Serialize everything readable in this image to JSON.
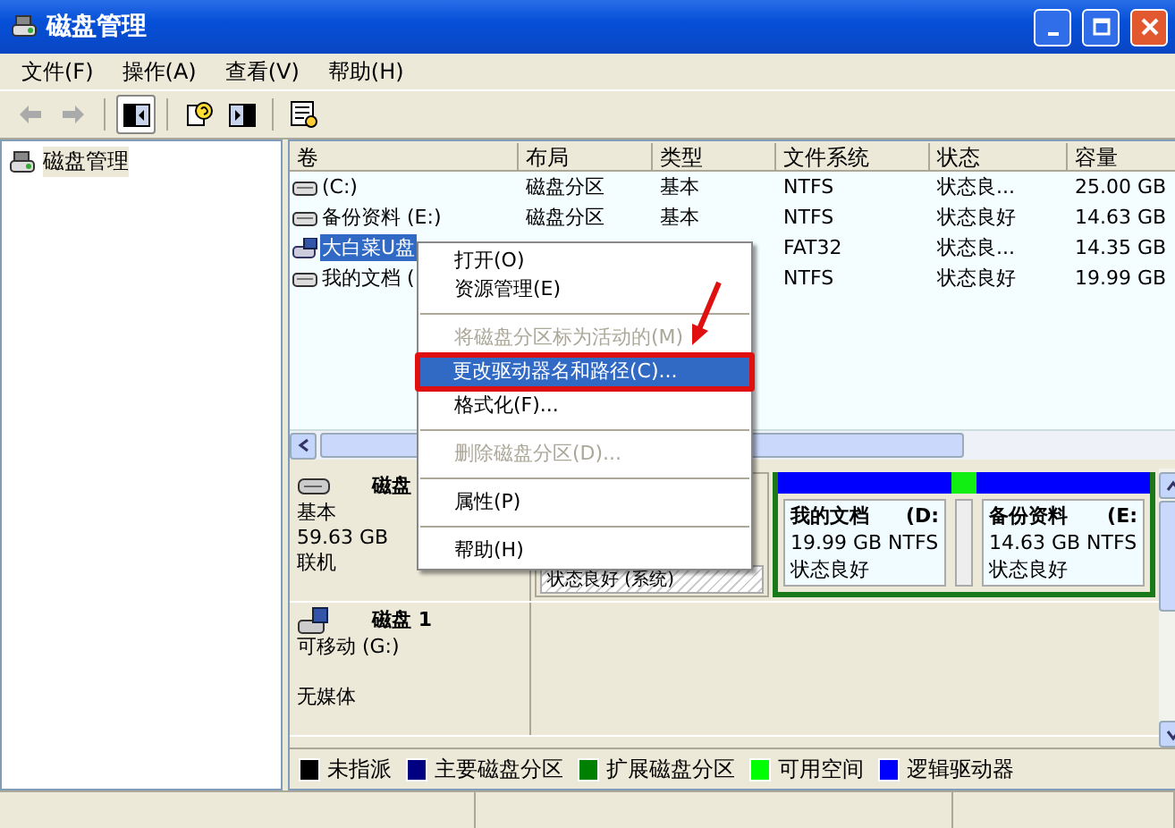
{
  "window": {
    "title": "磁盘管理"
  },
  "menu": [
    "文件(F)",
    "操作(A)",
    "查看(V)",
    "帮助(H)"
  ],
  "toolbar": [
    {
      "kind": "back",
      "disabled": true
    },
    {
      "kind": "forward",
      "disabled": true
    },
    {
      "kind": "sep"
    },
    {
      "kind": "tree",
      "pressed": true
    },
    {
      "kind": "sep"
    },
    {
      "kind": "help",
      "pressed": false
    },
    {
      "kind": "pane",
      "pressed": false
    },
    {
      "kind": "sep"
    },
    {
      "kind": "props",
      "pressed": false
    }
  ],
  "tree": [
    {
      "label": "磁盘管理",
      "selected": true
    }
  ],
  "table": {
    "columns": [
      "卷",
      "布局",
      "类型",
      "文件系统",
      "状态",
      "容量"
    ],
    "rows": [
      {
        "kind": "disk",
        "selected": false,
        "cells": [
          "(C:)",
          "磁盘分区",
          "基本",
          "NTFS",
          "状态良...",
          "25.00 GB"
        ]
      },
      {
        "kind": "disk",
        "selected": false,
        "cells": [
          "备份资料 (E:)",
          "磁盘分区",
          "基本",
          "NTFS",
          "状态良好",
          "14.63 GB"
        ]
      },
      {
        "kind": "usb",
        "selected": true,
        "cells": [
          "大白菜U盘",
          null,
          null,
          "FAT32",
          "状态良...",
          "14.35 GB"
        ]
      },
      {
        "kind": "disk",
        "selected": false,
        "cells": [
          "我的文档 (",
          null,
          null,
          "NTFS",
          "状态良好",
          "19.99 GB"
        ]
      }
    ]
  },
  "disks": [
    {
      "kind": "fixed",
      "name": "磁盘",
      "type": "基本",
      "size": "59.63 GB",
      "status": "联机",
      "partitions": [
        {
          "kind": "primary",
          "lines": [
            "状态良好 (系统)"
          ]
        },
        {
          "kind": "extended",
          "children": [
            {
              "kind": "logical",
              "title": "我的文档",
              "drive": "(D:",
              "lines": [
                "19.99 GB NTFS",
                "状态良好"
              ]
            },
            {
              "kind": "free"
            },
            {
              "kind": "logical",
              "title": "备份资料",
              "drive": "(E:",
              "lines": [
                "14.63 GB NTFS",
                "状态良好"
              ]
            }
          ]
        }
      ]
    },
    {
      "kind": "removable",
      "name": "磁盘 1",
      "type": "可移动 (G:)",
      "status": "无媒体"
    }
  ],
  "legend": [
    {
      "label": "未指派",
      "color": "#000000"
    },
    {
      "label": "主要磁盘分区",
      "color": "#000080"
    },
    {
      "label": "扩展磁盘分区",
      "color": "#008000"
    },
    {
      "label": "可用空间",
      "color": "#00ff00"
    },
    {
      "label": "逻辑驱动器",
      "color": "#0000ff"
    }
  ],
  "context_menu": [
    {
      "kind": "item",
      "label": "打开(O)",
      "disabled": false,
      "selected": false
    },
    {
      "kind": "item",
      "label": "资源管理(E)",
      "disabled": false,
      "selected": false
    },
    {
      "kind": "sep"
    },
    {
      "kind": "item",
      "label": "将磁盘分区标为活动的(M)",
      "disabled": true,
      "selected": false
    },
    {
      "kind": "item",
      "label": "更改驱动器名和路径(C)...",
      "disabled": false,
      "selected": true
    },
    {
      "kind": "item",
      "label": "格式化(F)...",
      "disabled": false,
      "selected": false
    },
    {
      "kind": "sep"
    },
    {
      "kind": "item",
      "label": "删除磁盘分区(D)...",
      "disabled": true,
      "selected": false
    },
    {
      "kind": "sep"
    },
    {
      "kind": "item",
      "label": "属性(P)",
      "disabled": false,
      "selected": false
    },
    {
      "kind": "sep"
    },
    {
      "kind": "item",
      "label": "帮助(H)",
      "disabled": false,
      "selected": false
    }
  ],
  "annotation": {
    "highlight_selected": true,
    "arrow": true
  }
}
